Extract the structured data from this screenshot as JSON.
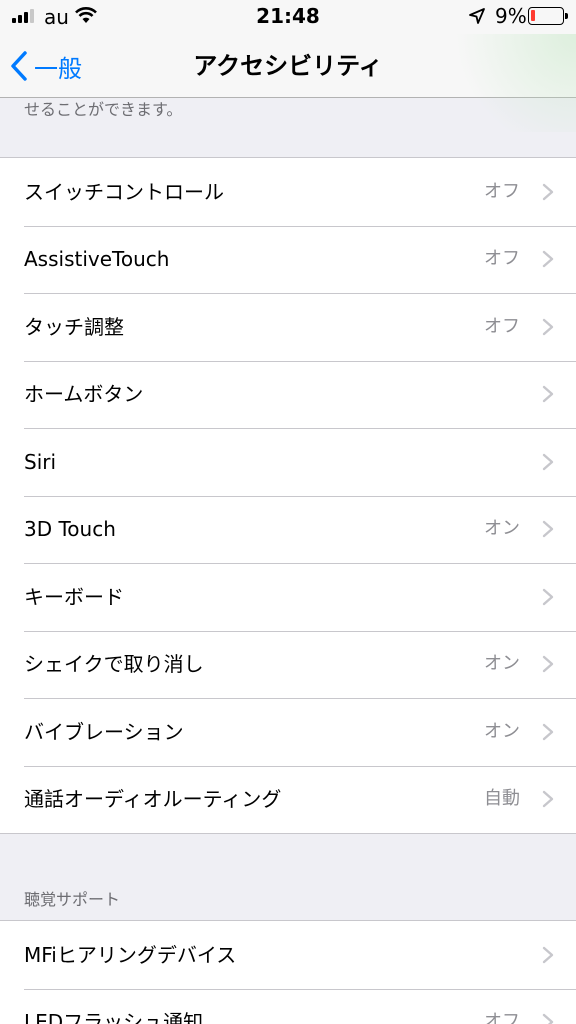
{
  "status_bar": {
    "carrier": "au",
    "time": "21:48",
    "battery_percent": "9%",
    "battery_level": 0.09,
    "battery_color": "#ff3b30",
    "signal_bars": 3,
    "icons": [
      "signal-icon",
      "wifi-icon",
      "location-arrow-icon",
      "battery-icon"
    ]
  },
  "nav": {
    "back_label": "一般",
    "title": "アクセシビリティ",
    "accent_color": "#007aff"
  },
  "top_note": "せることができます。",
  "interaction_section": {
    "rows": [
      {
        "label": "スイッチコントロール",
        "value": "オフ"
      },
      {
        "label": "AssistiveTouch",
        "value": "オフ"
      },
      {
        "label": "タッチ調整",
        "value": "オフ"
      },
      {
        "label": "ホームボタン",
        "value": ""
      },
      {
        "label": "Siri",
        "value": ""
      },
      {
        "label": "3D Touch",
        "value": "オン"
      },
      {
        "label": "キーボード",
        "value": ""
      },
      {
        "label": "シェイクで取り消し",
        "value": "オン"
      },
      {
        "label": "バイブレーション",
        "value": "オン"
      },
      {
        "label": "通話オーディオルーティング",
        "value": "自動"
      }
    ]
  },
  "hearing_section": {
    "header": "聴覚サポート",
    "rows": [
      {
        "label": "MFiヒアリングデバイス",
        "value": ""
      },
      {
        "label": "LEDフラッシュ通知",
        "value": "オフ"
      }
    ]
  }
}
